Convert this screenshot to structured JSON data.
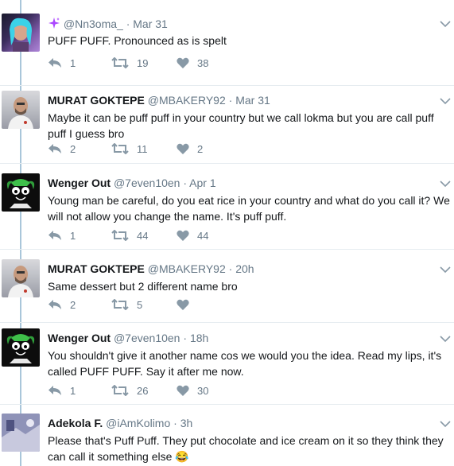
{
  "tweets": [
    {
      "avatar_icon": "user-avatar-woman",
      "name": "",
      "name_icon": "sparkle-icon",
      "handle": "@Nn3oma_",
      "time": "Mar 31",
      "text": "PUFF PUFF. Pronounced as is spelt",
      "replies": "1",
      "retweets": "19",
      "likes": "38"
    },
    {
      "avatar_icon": "user-avatar-man",
      "name": "MURAT GOKTEPE",
      "handle": "@MBAKERY92",
      "time": "Mar 31",
      "text": "Maybe it can be puff puff in your country  but we call lokma but you are call puff puff  I guess bro",
      "replies": "2",
      "retweets": "11",
      "likes": "2"
    },
    {
      "avatar_icon": "user-avatar-cartoon",
      "name": "Wenger Out",
      "handle": "@7even10en",
      "time": "Apr 1",
      "text": "Young man be careful, do you eat rice in your country and what do you call it? We will not allow you change the name. It's puff puff.",
      "replies": "1",
      "retweets": "44",
      "likes": "44"
    },
    {
      "avatar_icon": "user-avatar-man",
      "name": "MURAT GOKTEPE",
      "handle": "@MBAKERY92",
      "time": "20h",
      "text": "Same dessert but 2 different name bro",
      "replies": "2",
      "retweets": "5",
      "likes": ""
    },
    {
      "avatar_icon": "user-avatar-cartoon",
      "name": "Wenger Out",
      "handle": "@7even10en",
      "time": "18h",
      "text": "You shouldn't give it another name cos we would you the idea. Read my lips, it's called PUFF PUFF. Say it after me now.",
      "replies": "1",
      "retweets": "26",
      "likes": "30"
    },
    {
      "avatar_icon": "user-avatar-photo",
      "name": "Adekola F.",
      "handle": "@iAmKolimo",
      "time": "3h",
      "text": "Please that's Puff Puff. They put chocolate and ice cream on it so they think they can call it something else 😂",
      "replies": "",
      "retweets": "",
      "likes": ""
    }
  ],
  "separator": "·",
  "colors": {
    "thread_line": "#a9c6da",
    "text": "#14171a",
    "muted": "#657786",
    "sparkle": "#ab47ff"
  }
}
